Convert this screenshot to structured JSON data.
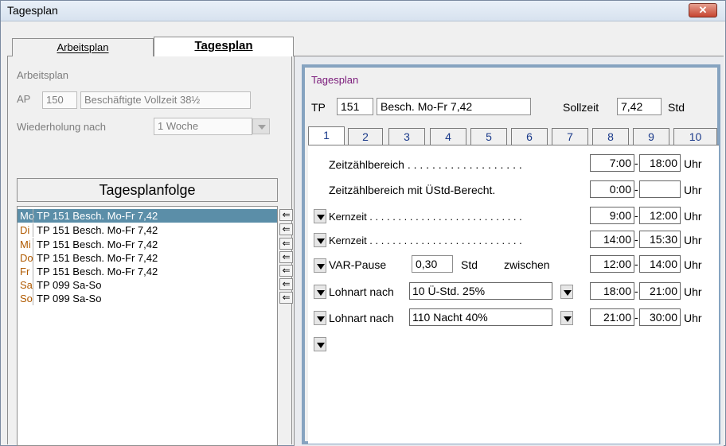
{
  "window": {
    "title": "Tagesplan",
    "close": "✕"
  },
  "tabs": {
    "arbeitsplan": "Arbeitsplan",
    "tagesplan": "Tagesplan"
  },
  "left": {
    "section_label": "Arbeitsplan",
    "ap_label": "AP",
    "ap_number": "150",
    "ap_name": "Beschäftigte Vollzeit 38½",
    "wiederholung_label": "Wiederholung nach",
    "wiederholung_value": "1 Woche",
    "tpf_header": "Tagesplanfolge",
    "rows": [
      {
        "day": "Mo",
        "text": "TP 151  Besch. Mo-Fr 7,42"
      },
      {
        "day": "Di",
        "text": "TP 151  Besch. Mo-Fr 7,42"
      },
      {
        "day": "Mi",
        "text": "TP 151  Besch. Mo-Fr 7,42"
      },
      {
        "day": "Do",
        "text": "TP 151  Besch. Mo-Fr 7,42"
      },
      {
        "day": "Fr",
        "text": "TP 151  Besch. Mo-Fr 7,42"
      },
      {
        "day": "Sa",
        "text": "TP 099  Sa-So"
      },
      {
        "day": "So",
        "text": "TP 099  Sa-So"
      }
    ],
    "arrow": "⇐"
  },
  "right": {
    "group_label": "Tagesplan",
    "tp_label": "TP",
    "tp_number": "151",
    "tp_name": "Besch. Mo-Fr 7,42",
    "sollzeit_label": "Sollzeit",
    "sollzeit_value": "7,42",
    "std_label": "Std",
    "subtabs": [
      "1",
      "2",
      "3",
      "4",
      "5",
      "6",
      "7",
      "8",
      "9",
      "10"
    ],
    "zeitzahl_label": "Zeitzählbereich . . . . . . . . . . . . . . . . . . .",
    "zeitzahl_from": "7:00",
    "zeitzahl_to": "18:00",
    "ueberstd_label": "Zeitzählbereich mit ÜStd-Berecht.",
    "ueberstd_from": "0:00",
    "ueberstd_to": "",
    "kern1_label": "Kernzeit . . . . . . . . . . . . . . . . . . . . . . . . . . .",
    "kern1_from": "9:00",
    "kern1_to": "12:00",
    "kern2_label": "Kernzeit . . . . . . . . . . . . . . . . . . . . . . . . . . .",
    "kern2_from": "14:00",
    "kern2_to": "15:30",
    "var_label": "VAR-Pause",
    "var_value": "0,30",
    "var_std": "Std",
    "var_zwischen": "zwischen",
    "var_from": "12:00",
    "var_to": "14:00",
    "lohn1_label": "Lohnart  nach",
    "lohn1_value": "10  Ü-Std. 25%",
    "lohn1_from": "18:00",
    "lohn1_to": "21:00",
    "lohn2_label": "Lohnart  nach",
    "lohn2_value": "110  Nacht 40%",
    "lohn2_from": "21:00",
    "lohn2_to": "30:00",
    "dash": "-",
    "uhr": "Uhr"
  }
}
